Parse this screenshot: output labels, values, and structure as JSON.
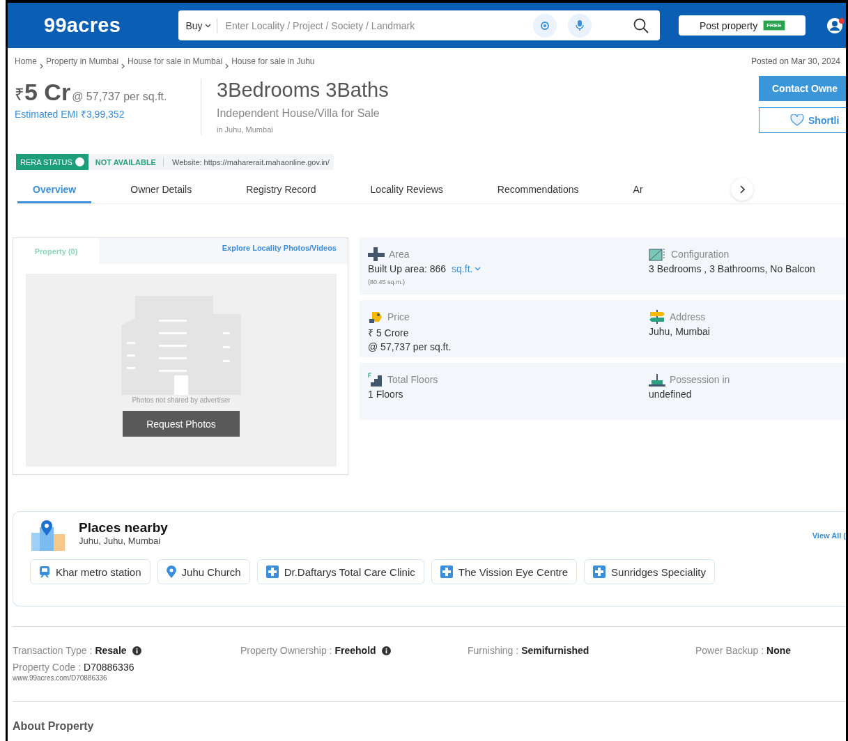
{
  "header": {
    "logo": "99acres",
    "search": {
      "mode": "Buy",
      "placeholder": "Enter Locality / Project / Society / Landmark"
    },
    "post_property": {
      "label": "Post property",
      "badge": "FREE"
    }
  },
  "breadcrumb": [
    "Home",
    "Property in Mumbai",
    "House for sale in Mumbai",
    "House for sale in Juhu"
  ],
  "posted": "Posted on Mar 30, 2024",
  "price": {
    "currency": "₹",
    "amount": "5 Cr",
    "per_sqft": "@ 57,737 per sq.ft.",
    "emi": "Estimated EMI ₹3,99,352"
  },
  "title": "3Bedrooms 3Baths",
  "subtitle": "Independent House/Villa for Sale",
  "location": "in Juhu, Mumbai",
  "actions": {
    "contact": "Contact Owne",
    "shortlist": "Shortli"
  },
  "rera": {
    "label": "RERA STATUS",
    "status": "NOT AVAILABLE",
    "website": "Website: https://maharerait.mahaonline.gov.in/"
  },
  "tabs": [
    {
      "label": "Overview",
      "selected": true
    },
    {
      "label": "Owner Details",
      "selected": false
    },
    {
      "label": "Registry Record",
      "selected": false
    },
    {
      "label": "Locality Reviews",
      "selected": false
    },
    {
      "label": "Recommendations",
      "selected": false
    },
    {
      "label": "Ar",
      "selected": false
    }
  ],
  "gallery": {
    "tab": {
      "label": "Property (0)",
      "selected": true
    },
    "explore": "Explore Locality Photos/Videos",
    "note": "Photos not shared by advertiser",
    "button": "Request Photos"
  },
  "details": [
    {
      "kind": "area",
      "label": "Area",
      "lines": [
        "Built Up area: 866"
      ],
      "unit": "sq.ft.",
      "sub": "(80.45 sq.m.)"
    },
    {
      "kind": "configuration",
      "label": "Configuration",
      "lines": [
        "3 Bedrooms , 3 Bathrooms, No Balcon"
      ]
    },
    {
      "kind": "price",
      "label": "Price",
      "lines": [
        "₹ 5 Crore",
        "@ 57,737 per sq.ft."
      ]
    },
    {
      "kind": "address",
      "label": "Address",
      "lines": [
        "Juhu, Mumbai"
      ]
    },
    {
      "kind": "floors",
      "label": "Total Floors",
      "lines": [
        "1 Floors"
      ]
    },
    {
      "kind": "possession",
      "label": "Possession in",
      "lines": [
        "undefined"
      ]
    }
  ],
  "places": {
    "title": "Places nearby",
    "subtitle": "Juhu, Juhu, Mumbai",
    "view_all": "View All (",
    "items": [
      {
        "kind": "metro",
        "label": "Khar metro station"
      },
      {
        "kind": "place",
        "label": "Juhu Church"
      },
      {
        "kind": "hospital",
        "label": "Dr.Daftarys Total Care Clinic"
      },
      {
        "kind": "hospital",
        "label": "The Vission Eye Centre"
      },
      {
        "kind": "hospital",
        "label": "Sunridges Speciality"
      }
    ]
  },
  "facts": [
    {
      "label": "Transaction Type :",
      "value": "Resale",
      "info": true
    },
    {
      "label": "Property Ownership :",
      "value": "Freehold",
      "info": true
    },
    {
      "label": "Furnishing :",
      "value": "Semifurnished",
      "info": false
    },
    {
      "label": "Power Backup :",
      "value": "None",
      "info": false
    }
  ],
  "code": {
    "label": "Property Code :",
    "value": "D70886336",
    "url": "www.99acres.com/D70886336"
  },
  "about": "About Property"
}
